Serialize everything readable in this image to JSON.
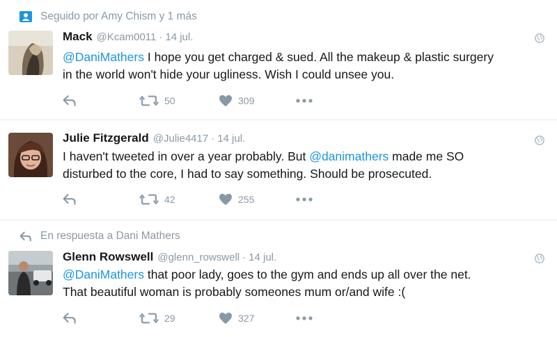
{
  "tweets": [
    {
      "context": "Seguido por Amy Chism y 1 más",
      "context_icon": "person-icon",
      "name": "Mack",
      "handle": "@Kcam0011",
      "sep": "·",
      "time": "14 jul.",
      "mention": "@DaniMathers",
      "text1": " I hope you get charged & sued. All the makeup & plastic surgery",
      "text2": "in the world won't hide your ugliness. Wish I could unsee you.",
      "retweets": "50",
      "likes": "309"
    },
    {
      "name": "Julie Fitzgerald",
      "handle": "@Julie4417",
      "sep": "·",
      "time": "14 jul.",
      "pre": "I haven't tweeted in over a year probably. But ",
      "mention": "@danimathers",
      "text1": " made me SO",
      "text2": "disturbed to the core, I had to say something. Should be prosecuted.",
      "retweets": "42",
      "likes": "255"
    },
    {
      "context": "En respuesta a Dani Mathers",
      "context_icon": "reply-arrow-icon",
      "name": "Glenn Rowswell",
      "handle": "@glenn_rowswell",
      "sep": "·",
      "time": "14 jul.",
      "mention": "@DaniMathers",
      "text1": " that poor lady, goes to the gym and ends up all over the net.",
      "text2": "That beautiful woman is probably someones mum or/and wife :(",
      "retweets": "29",
      "likes": "327"
    }
  ],
  "colors": {
    "link": "#1b95e0",
    "muted": "#8899a6",
    "text": "#14171a",
    "border": "#e6ecf0"
  }
}
